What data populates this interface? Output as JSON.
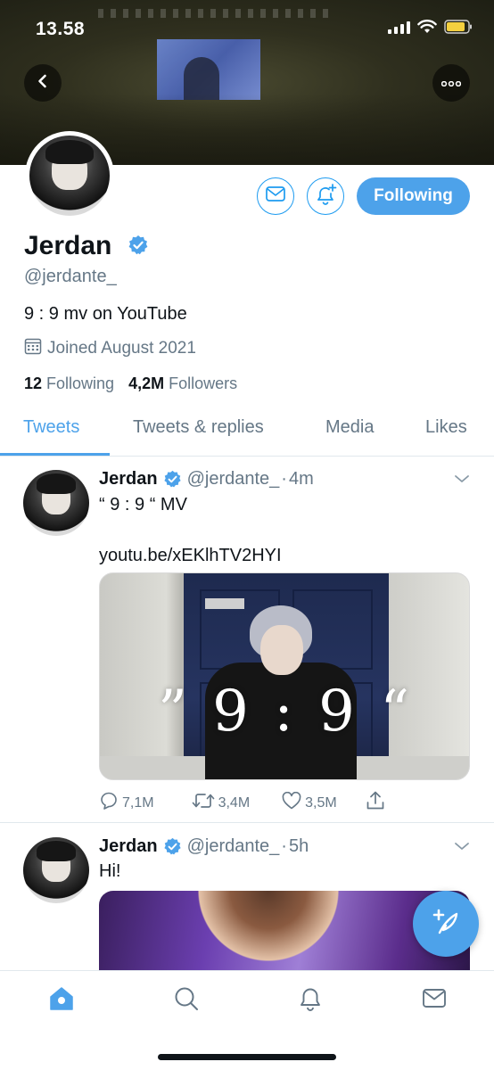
{
  "status_bar": {
    "time": "13.58"
  },
  "profile": {
    "name": "Jerdan",
    "handle": "@jerdante_",
    "bio": "9 : 9 mv on YouTube",
    "joined": "Joined August 2021",
    "following_count": "12",
    "following_label": "Following",
    "followers_count": "4,2M",
    "followers_label": "Followers",
    "follow_button_label": "Following",
    "verified": true
  },
  "tabs": [
    {
      "label": "Tweets",
      "active": true
    },
    {
      "label": "Tweets & replies",
      "active": false
    },
    {
      "label": "Media",
      "active": false
    },
    {
      "label": "Likes",
      "active": false
    }
  ],
  "tweets": [
    {
      "name": "Jerdan",
      "handle": "@jerdante_",
      "time": "4m",
      "text": "“ 9 : 9 “ MV",
      "link": "youtu.be/xEKlhTV2HYI",
      "media_overlay_text": "” 9 : 9 “",
      "replies": "7,1M",
      "retweets": "3,4M",
      "likes": "3,5M"
    },
    {
      "name": "Jerdan",
      "handle": "@jerdante_",
      "time": "5h",
      "text": "Hi!"
    }
  ],
  "icons": {
    "back": "chevron-left-icon",
    "more": "more-icon",
    "message": "mail-icon",
    "notify": "bell-plus-icon",
    "calendar": "calendar-icon",
    "verified": "verified-badge-icon",
    "compose": "compose-tweet-icon",
    "nav": [
      "home-icon",
      "search-icon",
      "notifications-icon",
      "messages-icon"
    ]
  },
  "colors": {
    "accent": "#4da2ea",
    "secondary_text": "#657786",
    "primary_text": "#0f1419"
  }
}
